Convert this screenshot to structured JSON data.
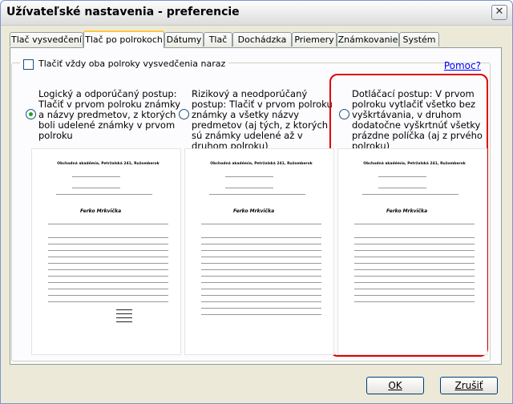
{
  "window": {
    "title": "Užívateľské nastavenia - preferencie",
    "close_label": "✕"
  },
  "tabs": [
    {
      "label": "Tlač vysvedčení",
      "active": false
    },
    {
      "label": "Tlač po polrokoch",
      "active": true
    },
    {
      "label": "Dátumy",
      "active": false
    },
    {
      "label": "Tlač",
      "active": false
    },
    {
      "label": "Dochádzka",
      "active": false
    },
    {
      "label": "Priemery",
      "active": false
    },
    {
      "label": "Známkovanie",
      "active": false
    },
    {
      "label": "Systém",
      "active": false
    }
  ],
  "panel": {
    "print_both_label": "Tlačiť vždy oba polroky vysvedčenia naraz",
    "print_both_checked": false,
    "help_link": "Pomoc?",
    "options": [
      {
        "text": "Logický a odporúčaný postup: Tlačiť v prvom polroku známky a názvy predmetov, z ktorých boli udelené známky v prvom polroku",
        "selected": true
      },
      {
        "text": "Rizikový a neodporúčaný postup: Tlačiť v prvom polroku známky a všetky názvy predmetov (aj tých, z ktorých sú známky udelené až v druhom polroku)",
        "selected": false
      },
      {
        "text": "Dotláčací postup: V prvom polroku vytlačiť všetko bez vyškrtávania, v druhom dodatočne vyškrtnúť všetky prázdne políčka (aj z prvého polroku)",
        "selected": false
      }
    ],
    "preview": {
      "school": "Obchodná akadémia, Petržalská 241, Ružomberok",
      "student": "Ferko Mrkvička"
    }
  },
  "buttons": {
    "ok": "OK",
    "cancel": "Zrušiť"
  }
}
